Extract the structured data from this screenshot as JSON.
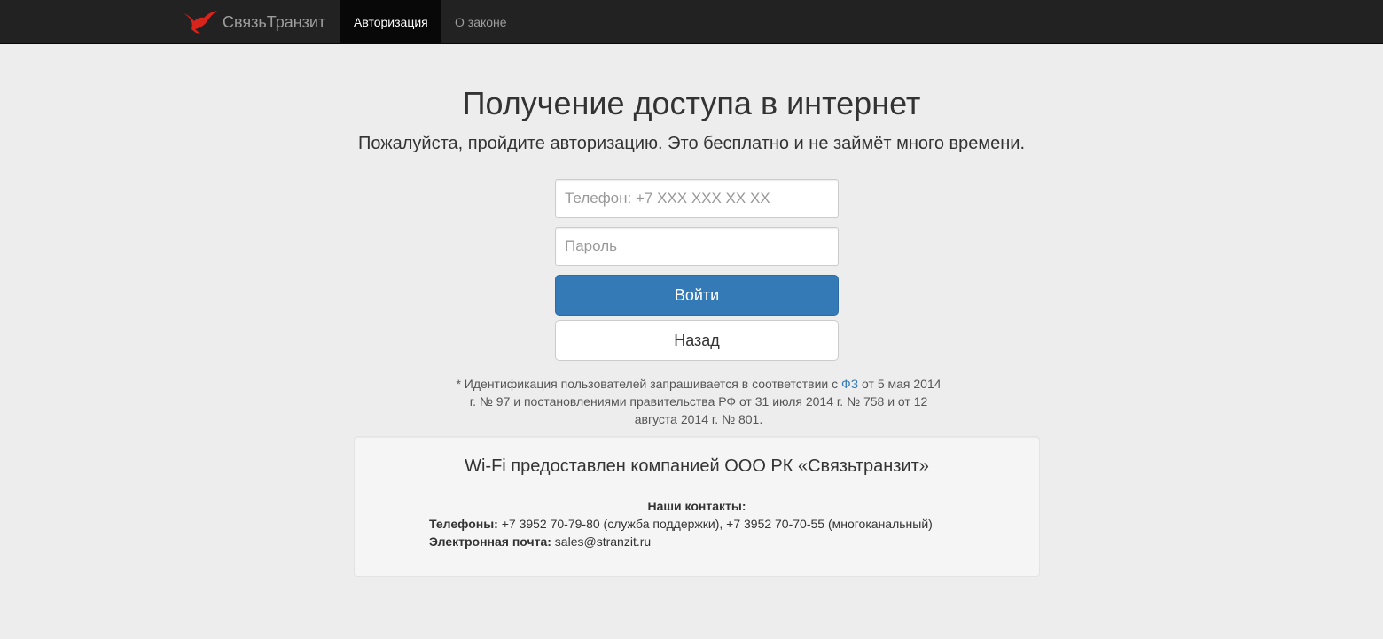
{
  "navbar": {
    "brand": "СвязьТранзит",
    "logo_icon": "bird-logo-icon",
    "items": [
      {
        "label": "Авторизация",
        "active": true
      },
      {
        "label": "О законе",
        "active": false
      }
    ]
  },
  "main": {
    "title": "Получение доступа в интернет",
    "subtitle": "Пожалуйста, пройдите авторизацию. Это бесплатно и не займёт много времени.",
    "phone_placeholder": "Телефон: +7 XXX XXX XX XX",
    "password_placeholder": "Пароль",
    "login_label": "Войти",
    "back_label": "Назад"
  },
  "note": {
    "part1": "* Идентификация пользователей запрашивается в соответствии с ",
    "link": "ФЗ",
    "part2": " от 5 мая 2014 г. № 97 и постановлениями правительства РФ от 31 июля 2014 г. № 758 и от 12 августа 2014 г. № 801."
  },
  "provider": {
    "title": "Wi-Fi предоставлен компанией ООО РК «Связьтранзит»",
    "contacts_heading": "Наши контакты:",
    "phones_label": "Телефоны:",
    "phones_value": " +7 3952 70-79-80 (служба поддержки), +7 3952 70-70-55 (многоканальный)",
    "email_label": "Электронная почта:",
    "email_value": " sales@stranzit.ru"
  },
  "colors": {
    "navbar": "#222222",
    "primary": "#337ab7",
    "logo_red": "#d9241c",
    "background": "#ededed"
  }
}
